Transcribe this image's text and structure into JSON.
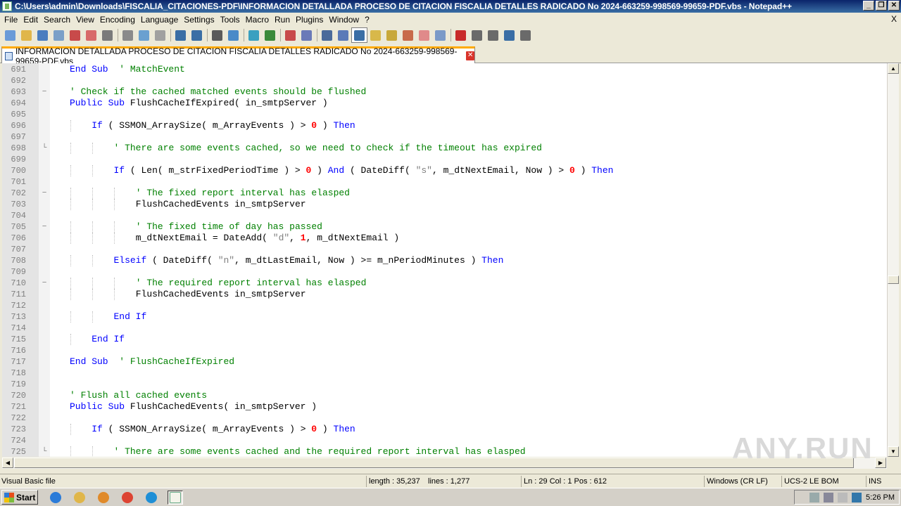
{
  "window": {
    "title": "C:\\Users\\admin\\Downloads\\FISCALIA_CITACIONES-PDF\\INFORMACION DETALLADA PROCESO DE CITACION FISCALIA DETALLES RADICADO No 2024-663259-998569-99659-PDF.vbs - Notepad++",
    "minimize": "_",
    "restore": "❐",
    "close": "✕"
  },
  "menu": {
    "items": [
      "File",
      "Edit",
      "Search",
      "View",
      "Encoding",
      "Language",
      "Settings",
      "Tools",
      "Macro",
      "Run",
      "Plugins",
      "Window",
      "?"
    ],
    "close_doc": "X"
  },
  "toolbar": {
    "icons": [
      "new-file-icon",
      "open-file-icon",
      "save-icon",
      "save-all-icon",
      "close-icon",
      "close-all-icon",
      "print-icon",
      "sep",
      "cut-icon",
      "copy-icon",
      "paste-icon",
      "sep",
      "undo-icon",
      "redo-icon",
      "sep",
      "find-icon",
      "replace-icon",
      "sep",
      "zoom-in-icon",
      "zoom-out-icon",
      "sep",
      "sync-vertical-icon",
      "sync-horizontal-icon",
      "sep",
      "word-wrap-icon",
      "show-all-chars-icon",
      "indent-guide-icon",
      "language-udl-icon",
      "document-map-icon",
      "function-list-icon",
      "folder-as-workspace-icon",
      "monitoring-icon",
      "sep",
      "record-macro-icon",
      "stop-macro-icon",
      "play-macro-icon",
      "run-macro-multiple-icon",
      "save-macro-icon"
    ]
  },
  "tab": {
    "label": "INFORMACION DETALLADA PROCESO DE CITACION FISCALIA DETALLES RADICADO No 2024-663259-998569-99659-PDF.vbs"
  },
  "editor": {
    "lines": [
      {
        "n": "691",
        "fold": "",
        "indent": 1,
        "tokens": [
          [
            "k",
            "End Sub"
          ],
          [
            "",
            "  "
          ],
          [
            "c",
            "' MatchEvent"
          ]
        ]
      },
      {
        "n": "692",
        "fold": "",
        "indent": 0,
        "tokens": []
      },
      {
        "n": "693",
        "fold": "−",
        "indent": 1,
        "tokens": [
          [
            "c",
            "' Check if the cached matched events should be flushed"
          ]
        ]
      },
      {
        "n": "694",
        "fold": "",
        "indent": 1,
        "tokens": [
          [
            "k",
            "Public Sub"
          ],
          [
            "",
            " FlushCacheIfExpired( in_smtpServer )"
          ]
        ]
      },
      {
        "n": "695",
        "fold": "",
        "indent": 0,
        "tokens": []
      },
      {
        "n": "696",
        "fold": "",
        "indent": 2,
        "tokens": [
          [
            "k",
            "If"
          ],
          [
            "",
            " ( SSMON_ArraySize( m_ArrayEvents ) > "
          ],
          [
            "n",
            "0"
          ],
          [
            "",
            " ) "
          ],
          [
            "k",
            "Then"
          ]
        ]
      },
      {
        "n": "697",
        "fold": "",
        "indent": 0,
        "tokens": []
      },
      {
        "n": "698",
        "fold": "└",
        "indent": 3,
        "tokens": [
          [
            "c",
            "' There are some events cached, so we need to check if the timeout has expired"
          ]
        ]
      },
      {
        "n": "699",
        "fold": "",
        "indent": 0,
        "tokens": []
      },
      {
        "n": "700",
        "fold": "",
        "indent": 3,
        "tokens": [
          [
            "k",
            "If"
          ],
          [
            "",
            " ( Len( m_strFixedPeriodTime ) > "
          ],
          [
            "n",
            "0"
          ],
          [
            "",
            " ) "
          ],
          [
            "k",
            "And"
          ],
          [
            "",
            " ( DateDiff( "
          ],
          [
            "s",
            "\"s\""
          ],
          [
            "",
            ", m_dtNextEmail, Now ) > "
          ],
          [
            "n",
            "0"
          ],
          [
            "",
            " ) "
          ],
          [
            "k",
            "Then"
          ]
        ]
      },
      {
        "n": "701",
        "fold": "",
        "indent": 0,
        "tokens": []
      },
      {
        "n": "702",
        "fold": "−",
        "indent": 4,
        "tokens": [
          [
            "c",
            "' The fixed report interval has elasped"
          ]
        ]
      },
      {
        "n": "703",
        "fold": "",
        "indent": 4,
        "tokens": [
          [
            "",
            "FlushCachedEvents in_smtpServer"
          ]
        ]
      },
      {
        "n": "704",
        "fold": "",
        "indent": 0,
        "tokens": []
      },
      {
        "n": "705",
        "fold": "−",
        "indent": 4,
        "tokens": [
          [
            "c",
            "' The fixed time of day has passed"
          ]
        ]
      },
      {
        "n": "706",
        "fold": "",
        "indent": 4,
        "tokens": [
          [
            "",
            "m_dtNextEmail = DateAdd( "
          ],
          [
            "s",
            "\"d\""
          ],
          [
            "",
            ", "
          ],
          [
            "n",
            "1"
          ],
          [
            "",
            ", m_dtNextEmail )"
          ]
        ]
      },
      {
        "n": "707",
        "fold": "",
        "indent": 0,
        "tokens": []
      },
      {
        "n": "708",
        "fold": "",
        "indent": 3,
        "tokens": [
          [
            "k",
            "Elseif"
          ],
          [
            "",
            " ( DateDiff( "
          ],
          [
            "s",
            "\"n\""
          ],
          [
            "",
            ", m_dtLastEmail, Now ) >= m_nPeriodMinutes ) "
          ],
          [
            "k",
            "Then"
          ]
        ]
      },
      {
        "n": "709",
        "fold": "",
        "indent": 0,
        "tokens": []
      },
      {
        "n": "710",
        "fold": "−",
        "indent": 4,
        "tokens": [
          [
            "c",
            "' The required report interval has elasped"
          ]
        ]
      },
      {
        "n": "711",
        "fold": "",
        "indent": 4,
        "tokens": [
          [
            "",
            "FlushCachedEvents in_smtpServer"
          ]
        ]
      },
      {
        "n": "712",
        "fold": "",
        "indent": 0,
        "tokens": []
      },
      {
        "n": "713",
        "fold": "",
        "indent": 3,
        "tokens": [
          [
            "k",
            "End If"
          ]
        ]
      },
      {
        "n": "714",
        "fold": "",
        "indent": 0,
        "tokens": []
      },
      {
        "n": "715",
        "fold": "",
        "indent": 2,
        "tokens": [
          [
            "k",
            "End If"
          ]
        ]
      },
      {
        "n": "716",
        "fold": "",
        "indent": 0,
        "tokens": []
      },
      {
        "n": "717",
        "fold": "",
        "indent": 1,
        "tokens": [
          [
            "k",
            "End Sub"
          ],
          [
            "",
            "  "
          ],
          [
            "c",
            "' FlushCacheIfExpired"
          ]
        ]
      },
      {
        "n": "718",
        "fold": "",
        "indent": 0,
        "tokens": []
      },
      {
        "n": "719",
        "fold": "",
        "indent": 0,
        "tokens": []
      },
      {
        "n": "720",
        "fold": "",
        "indent": 1,
        "tokens": [
          [
            "c",
            "' Flush all cached events"
          ]
        ]
      },
      {
        "n": "721",
        "fold": "",
        "indent": 1,
        "tokens": [
          [
            "k",
            "Public Sub"
          ],
          [
            "",
            " FlushCachedEvents( in_smtpServer )"
          ]
        ]
      },
      {
        "n": "722",
        "fold": "",
        "indent": 0,
        "tokens": []
      },
      {
        "n": "723",
        "fold": "",
        "indent": 2,
        "tokens": [
          [
            "k",
            "If"
          ],
          [
            "",
            " ( SSMON_ArraySize( m_ArrayEvents ) > "
          ],
          [
            "n",
            "0"
          ],
          [
            "",
            " ) "
          ],
          [
            "k",
            "Then"
          ]
        ]
      },
      {
        "n": "724",
        "fold": "",
        "indent": 0,
        "tokens": []
      },
      {
        "n": "725",
        "fold": "└",
        "indent": 3,
        "tokens": [
          [
            "c",
            "' There are some events cached and the required report interval has elasped"
          ]
        ]
      }
    ]
  },
  "statusbar": {
    "file_type": "Visual Basic file",
    "length": "length : 35,237",
    "lines": "lines : 1,277",
    "position": "Ln : 29    Col : 1    Pos : 612",
    "eol": "Windows (CR LF)",
    "encoding": "UCS-2 LE BOM",
    "mode": "INS"
  },
  "taskbar": {
    "start": "Start",
    "quick_launch": [
      "ie-icon",
      "explorer-icon",
      "media-player-icon",
      "chrome-icon",
      "edge-icon",
      "notepadpp-icon"
    ],
    "clock": "5:26 PM"
  },
  "watermark": "ANY.RUN",
  "colors": {
    "keyword": "#0000ff",
    "comment": "#008000",
    "number": "#ff0000",
    "string": "#808080",
    "titlebar": "#0a246a",
    "tab_accent": "#ffaa00"
  }
}
